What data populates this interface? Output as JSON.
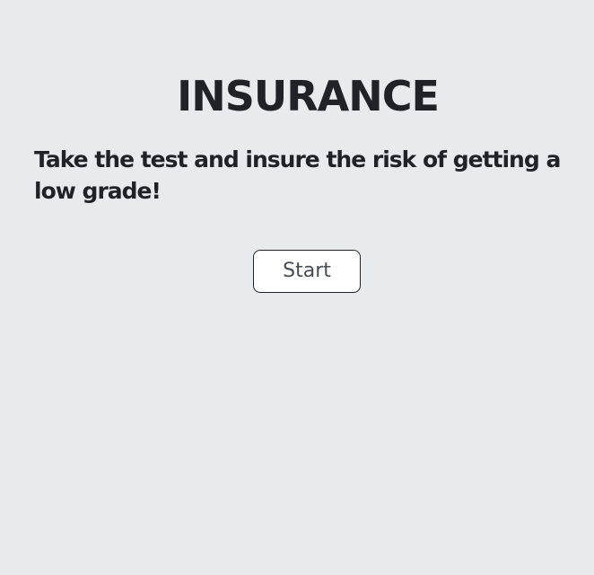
{
  "page": {
    "title": "INSURANCE",
    "subtitle": "Take the test and insure the risk of getting a low grade!",
    "start_button_label": "Start"
  },
  "colors": {
    "background": "#e8ebee",
    "text": "#1f2327",
    "button_background": "#ffffff",
    "button_text": "#474d53",
    "button_border": "#1f2327"
  }
}
